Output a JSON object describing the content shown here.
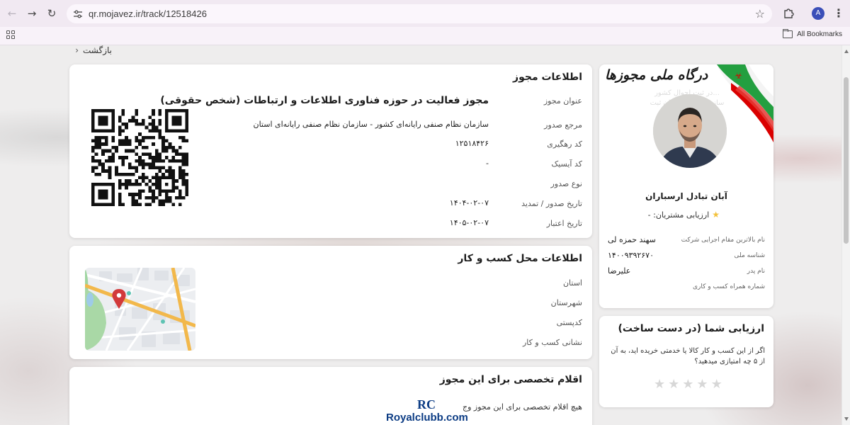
{
  "browser": {
    "url": "qr.mojavez.ir/track/12518426",
    "all_bookmarks_label": "All Bookmarks",
    "profile_initial": "A"
  },
  "page": {
    "back_label": "بازگشت",
    "license_card": {
      "title": "اطلاعات مجوز",
      "fields": [
        {
          "label": "عنوان مجوز",
          "value": "مجوز فعالیت در حوزه فناوری اطلاعات و ارتباطات (شخص حقوقی)"
        },
        {
          "label": "مرجع صدور",
          "value": "سازمان نظام صنفی رایانه‌ای کشور - سازمان نظام صنفی رایانه‌ای استان"
        },
        {
          "label": "کد رهگیری",
          "value": "۱۲۵۱۸۴۲۶"
        },
        {
          "label": "کد آیسیک",
          "value": "-"
        },
        {
          "label": "نوع صدور",
          "value": ""
        },
        {
          "label": "تاریخ صدور / تمدید",
          "value": "۱۴۰۴-۰۲-۰۷"
        },
        {
          "label": "تاریخ اعتبار",
          "value": "۱۴۰۵-۰۲-۰۷"
        }
      ]
    },
    "location_card": {
      "title": "اطلاعات محل کسب و کار",
      "fields": [
        {
          "label": "استان",
          "value": ""
        },
        {
          "label": "شهرستان",
          "value": ""
        },
        {
          "label": "کدپستی",
          "value": ""
        },
        {
          "label": "نشانی کسب و کار",
          "value": ""
        }
      ]
    },
    "items_card": {
      "title": "اقلام تخصصی برای این مجوز",
      "empty_text": "هیچ اقلام تخصصی برای این مجوز وج"
    },
    "profile_card": {
      "logo_text": "درگاه ملی مجوزها",
      "background_text": "...در ثبت احوال کشور سازمان ثبت سازمان ثبت سازمان ثبت",
      "name": "آبان تبادل ارسباران",
      "rating_label": "ارزیابی مشتریان: -",
      "fields": [
        {
          "label": "نام بالاترین مقام اجرایی شرکت",
          "value": "سهند حمزه لی"
        },
        {
          "label": "شناسه ملی",
          "value": "۱۴۰۰۹۳۹۲۶۷۰"
        },
        {
          "label": "نام پدر",
          "value": "علیرضا"
        },
        {
          "label": "شماره همراه کسب و کاری",
          "value": ""
        }
      ]
    },
    "rating_card": {
      "title": "ارزیابی شما (در دست ساخت)",
      "question": "اگر از این کسب و کار کالا یا خدمتی خریده اید، به آن از ۵ چه امتیازی میدهید؟",
      "stars": 5,
      "stars_filled": 0
    },
    "watermark": {
      "icon_text": "RC",
      "text": "Royalclubb.com"
    }
  },
  "colors": {
    "flag_green": "#239f40",
    "flag_red": "#da0000",
    "map_road": "#f2b84b",
    "map_pin": "#d23a3a",
    "watermark_blue": "#0c3c84"
  }
}
